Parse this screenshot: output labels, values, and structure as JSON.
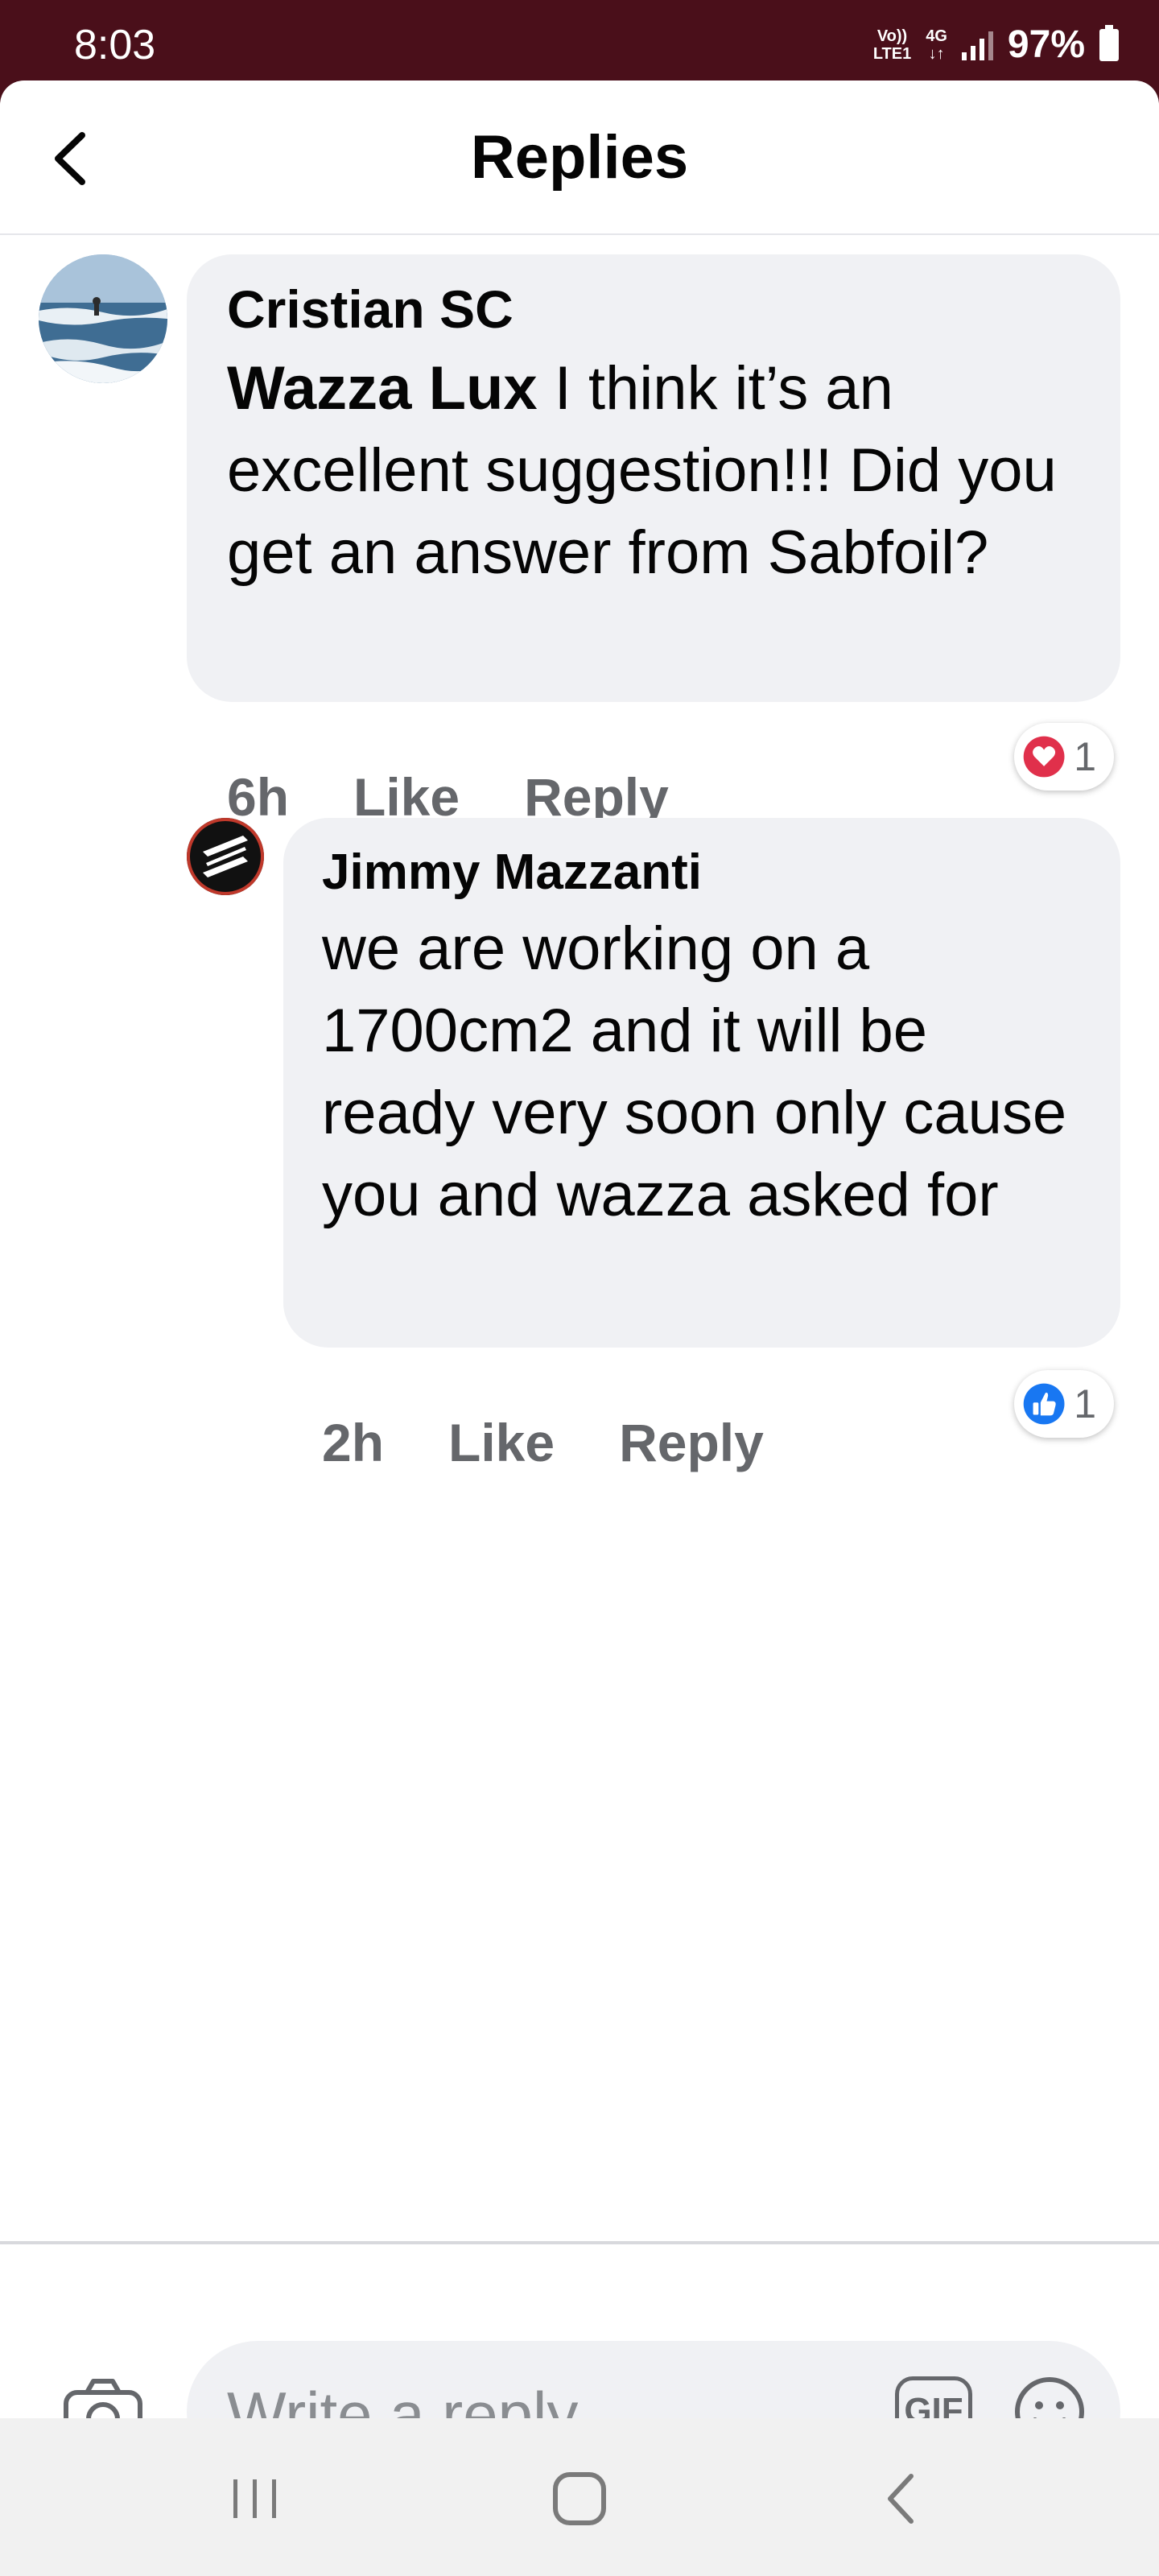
{
  "status_bar": {
    "time": "8:03",
    "network_top": "Vo))",
    "network_bottom": "LTE1",
    "network_type": "4G",
    "battery": "97%"
  },
  "header": {
    "title": "Replies"
  },
  "comments": [
    {
      "author": "Cristian SC",
      "mention": "Wazza Lux",
      "text": " I think it’s an excellent suggestion!!!  Did you get an answer from Sabfoil?",
      "time": "6h",
      "like_label": "Like",
      "reply_label": "Reply",
      "reaction": "heart",
      "reaction_count": "1"
    },
    {
      "author": "Jimmy Mazzanti",
      "text": "we are working on a 1700cm2 and it will be ready very soon only cause you and wazza asked for",
      "time": "2h",
      "like_label": "Like",
      "reply_label": "Reply",
      "reaction": "thumbs-up",
      "reaction_count": "1"
    }
  ],
  "composer": {
    "placeholder": "Write a reply...",
    "gif_label": "GIF"
  },
  "colors": {
    "status_bar": "#4a0f1a",
    "bubble": "#f0f1f4",
    "meta_text": "#65676b",
    "heart": "#e0304b",
    "like_blue": "#1877f2"
  }
}
